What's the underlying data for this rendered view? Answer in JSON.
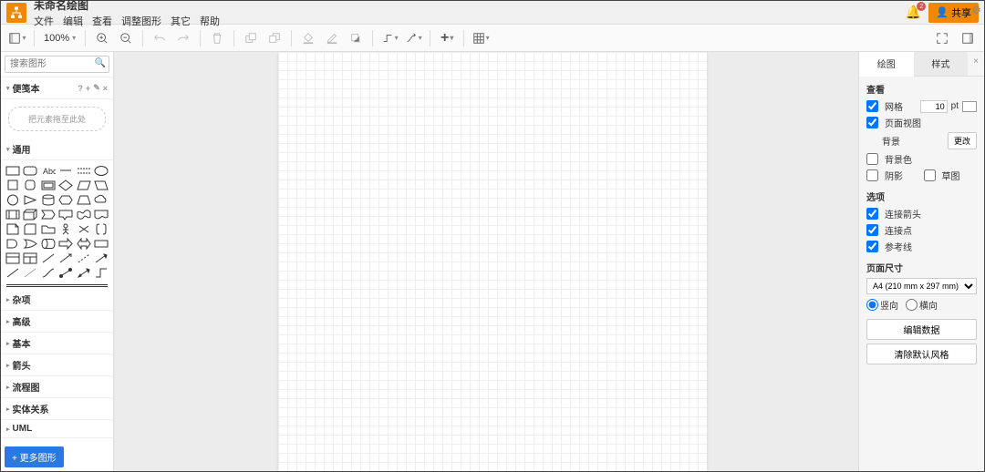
{
  "header": {
    "doc_title": "未命名绘图",
    "menu": [
      "文件",
      "编辑",
      "查看",
      "调整图形",
      "其它",
      "帮助"
    ],
    "notif_count": "2",
    "share_label": "共享"
  },
  "toolbar": {
    "zoom": "100%"
  },
  "sidebar": {
    "search_placeholder": "搜索图形",
    "scratchpad_title": "便笺本",
    "scratchpad_hint": "把元素拖至此处",
    "categories": [
      "通用",
      "杂项",
      "高级",
      "基本",
      "箭头",
      "流程图",
      "实体关系",
      "UML"
    ],
    "more_shapes": "+ 更多图形"
  },
  "rightpanel": {
    "tabs": {
      "diagram": "绘图",
      "style": "样式"
    },
    "view_title": "查看",
    "grid_label": "网格",
    "grid_size": "10",
    "grid_unit": "pt",
    "pageview_label": "页面视图",
    "background_label": "背景",
    "change_btn": "更改",
    "bgcolor_label": "背景色",
    "shadow_label": "阴影",
    "sketch_label": "草图",
    "options_title": "选项",
    "conn_arrows": "连接箭头",
    "conn_points": "连接点",
    "guides": "参考线",
    "pagesize_title": "页面尺寸",
    "pagesize_value": "A4 (210 mm x 297 mm)",
    "portrait": "竖向",
    "landscape": "横向",
    "edit_data": "编辑数据",
    "clear_default": "清除默认风格"
  },
  "chart_data": null
}
